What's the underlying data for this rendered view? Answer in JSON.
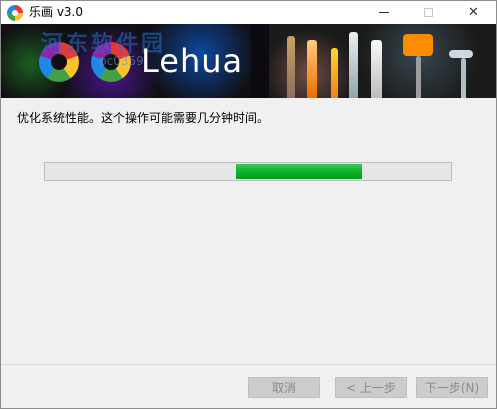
{
  "window": {
    "title": "乐画 v3.0",
    "controls": {
      "minimize": "minimize",
      "maximize": "maximize",
      "close": "✕"
    }
  },
  "banner": {
    "brand_name": "Lehua",
    "watermark": "河东软件园",
    "watermark_url": "pc0359"
  },
  "main": {
    "message": "优化系统性能。这个操作可能需要几分钟时间。",
    "progress": {
      "segment_start": 0.47,
      "segment_end": 0.78,
      "color": "#06b025"
    }
  },
  "footer": {
    "cancel_label": "取消",
    "back_label": "< 上一步",
    "next_label": "下一步(N)"
  }
}
